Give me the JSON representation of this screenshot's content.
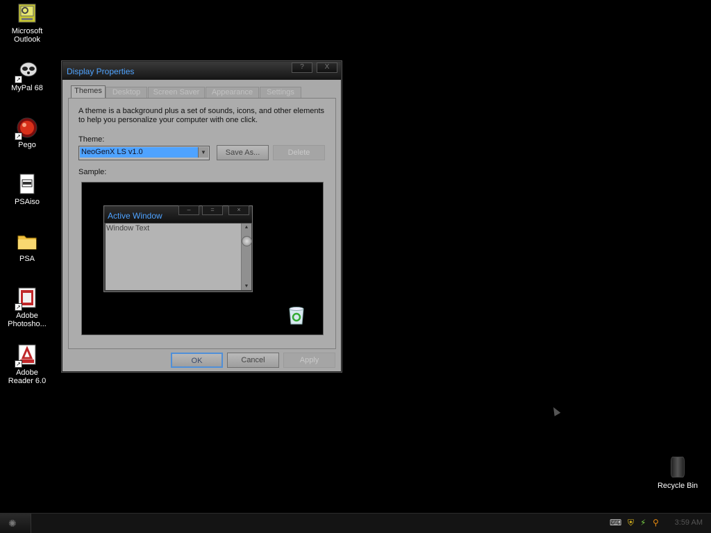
{
  "desktop": {
    "icons": [
      {
        "label_1": "Microsoft",
        "label_2": "Outlook"
      },
      {
        "label_1": "MyPal 68",
        "label_2": ""
      },
      {
        "label_1": "Pego",
        "label_2": ""
      },
      {
        "label_1": "PSAiso",
        "label_2": ""
      },
      {
        "label_1": "PSA",
        "label_2": ""
      },
      {
        "label_1": "Adobe",
        "label_2": "Photosho..."
      },
      {
        "label_1": "Adobe",
        "label_2": "Reader 6.0"
      }
    ],
    "recycle_bin": "Recycle Bin"
  },
  "dialog": {
    "title": "Display Properties",
    "help_btn": "?",
    "close_btn": "X",
    "tabs": [
      "Themes",
      "Desktop",
      "Screen Saver",
      "Appearance",
      "Settings"
    ],
    "description_line1": "A theme is a background plus a set of sounds, icons, and other elements",
    "description_line2": "to help you personalize your computer with one click.",
    "theme_label": "Theme:",
    "theme_value": "NeoGenX LS v1.0",
    "save_as": "Save As...",
    "delete": "Delete",
    "sample_label": "Sample:",
    "sample": {
      "window_title": "Active Window",
      "window_text": "Window Text"
    },
    "ok": "OK",
    "cancel": "Cancel",
    "apply": "Apply"
  },
  "taskbar": {
    "clock": "3:59 AM"
  },
  "colors": {
    "accent": "#4fa3ff",
    "dialog_bg": "#a9a9a9",
    "desktop_bg": "#000000"
  }
}
